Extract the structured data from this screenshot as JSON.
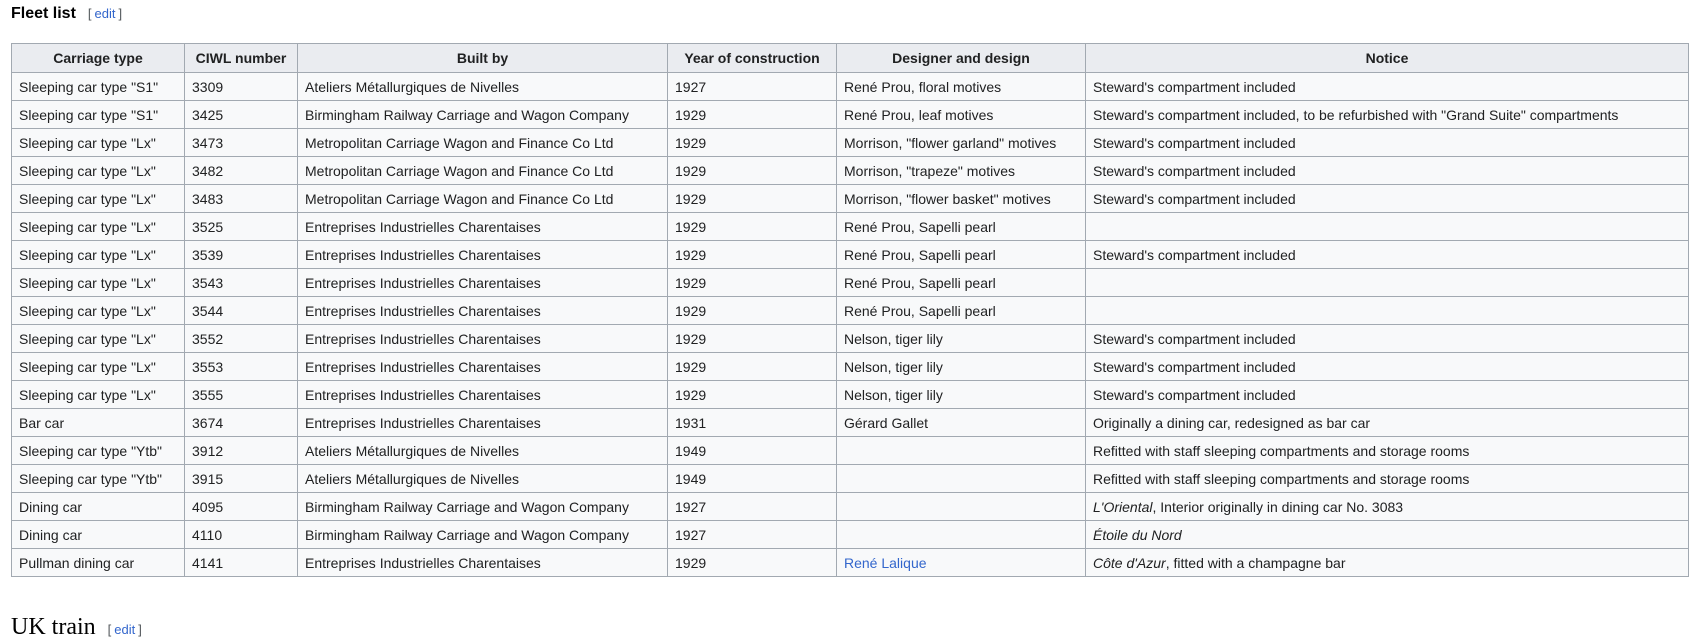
{
  "section": {
    "title": "Fleet list",
    "edit_label": "edit",
    "bracket_open": "[",
    "bracket_close": "]"
  },
  "table": {
    "headers": [
      "Carriage type",
      "CIWL number",
      "Built by",
      "Year of construction",
      "Designer and design",
      "Notice"
    ],
    "rows": [
      {
        "type": "Sleeping car type \"S1\"",
        "number": "3309",
        "builder": "Ateliers Métallurgiques de Nivelles",
        "year": "1927",
        "designer": "René Prou, floral motives",
        "notice_italic": "",
        "notice": "Steward's compartment included"
      },
      {
        "type": "Sleeping car type \"S1\"",
        "number": "3425",
        "builder": "Birmingham Railway Carriage and Wagon Company",
        "year": "1929",
        "designer": "René Prou, leaf motives",
        "notice_italic": "",
        "notice": "Steward's compartment included, to be refurbished with \"Grand Suite\" compartments"
      },
      {
        "type": "Sleeping car type \"Lx\"",
        "number": "3473",
        "builder": "Metropolitan Carriage Wagon and Finance Co Ltd",
        "year": "1929",
        "designer": "Morrison, \"flower garland\" motives",
        "notice_italic": "",
        "notice": "Steward's compartment included"
      },
      {
        "type": "Sleeping car type \"Lx\"",
        "number": "3482",
        "builder": "Metropolitan Carriage Wagon and Finance Co Ltd",
        "year": "1929",
        "designer": "Morrison, \"trapeze\" motives",
        "notice_italic": "",
        "notice": "Steward's compartment included"
      },
      {
        "type": "Sleeping car type \"Lx\"",
        "number": "3483",
        "builder": "Metropolitan Carriage Wagon and Finance Co Ltd",
        "year": "1929",
        "designer": "Morrison, \"flower basket\" motives",
        "notice_italic": "",
        "notice": "Steward's compartment included"
      },
      {
        "type": "Sleeping car type \"Lx\"",
        "number": "3525",
        "builder": "Entreprises Industrielles Charentaises",
        "year": "1929",
        "designer": "René Prou, Sapelli pearl",
        "notice_italic": "",
        "notice": ""
      },
      {
        "type": "Sleeping car type \"Lx\"",
        "number": "3539",
        "builder": "Entreprises Industrielles Charentaises",
        "year": "1929",
        "designer": "René Prou, Sapelli pearl",
        "notice_italic": "",
        "notice": "Steward's compartment included"
      },
      {
        "type": "Sleeping car type \"Lx\"",
        "number": "3543",
        "builder": "Entreprises Industrielles Charentaises",
        "year": "1929",
        "designer": "René Prou, Sapelli pearl",
        "notice_italic": "",
        "notice": ""
      },
      {
        "type": "Sleeping car type \"Lx\"",
        "number": "3544",
        "builder": "Entreprises Industrielles Charentaises",
        "year": "1929",
        "designer": "René Prou, Sapelli pearl",
        "notice_italic": "",
        "notice": ""
      },
      {
        "type": "Sleeping car type \"Lx\"",
        "number": "3552",
        "builder": "Entreprises Industrielles Charentaises",
        "year": "1929",
        "designer": "Nelson, tiger lily",
        "notice_italic": "",
        "notice": "Steward's compartment included"
      },
      {
        "type": "Sleeping car type \"Lx\"",
        "number": "3553",
        "builder": "Entreprises Industrielles Charentaises",
        "year": "1929",
        "designer": "Nelson, tiger lily",
        "notice_italic": "",
        "notice": "Steward's compartment included"
      },
      {
        "type": "Sleeping car type \"Lx\"",
        "number": "3555",
        "builder": "Entreprises Industrielles Charentaises",
        "year": "1929",
        "designer": "Nelson, tiger lily",
        "notice_italic": "",
        "notice": "Steward's compartment included"
      },
      {
        "type": "Bar car",
        "number": "3674",
        "builder": "Entreprises Industrielles Charentaises",
        "year": "1931",
        "designer": "Gérard Gallet",
        "notice_italic": "",
        "notice": "Originally a dining car, redesigned as bar car"
      },
      {
        "type": "Sleeping car type \"Ytb\"",
        "number": "3912",
        "builder": "Ateliers Métallurgiques de Nivelles",
        "year": "1949",
        "designer": "",
        "notice_italic": "",
        "notice": "Refitted with staff sleeping compartments and storage rooms"
      },
      {
        "type": "Sleeping car type \"Ytb\"",
        "number": "3915",
        "builder": "Ateliers Métallurgiques de Nivelles",
        "year": "1949",
        "designer": "",
        "notice_italic": "",
        "notice": "Refitted with staff sleeping compartments and storage rooms"
      },
      {
        "type": "Dining car",
        "number": "4095",
        "builder": "Birmingham Railway Carriage and Wagon Company",
        "year": "1927",
        "designer": "",
        "notice_italic": "L'Oriental",
        "notice": ", Interior originally in dining car No. 3083"
      },
      {
        "type": "Dining car",
        "number": "4110",
        "builder": "Birmingham Railway Carriage and Wagon Company",
        "year": "1927",
        "designer": "",
        "notice_italic": "Étoile du Nord",
        "notice": ""
      },
      {
        "type": "Pullman dining car",
        "number": "4141",
        "builder": "Entreprises Industrielles Charentaises",
        "year": "1929",
        "designer_link": "René Lalique",
        "designer": "",
        "notice_italic": "Côte d'Azur",
        "notice": ", fitted with a champagne bar"
      }
    ]
  },
  "next_section": {
    "title": "UK train",
    "edit_label": "edit"
  }
}
